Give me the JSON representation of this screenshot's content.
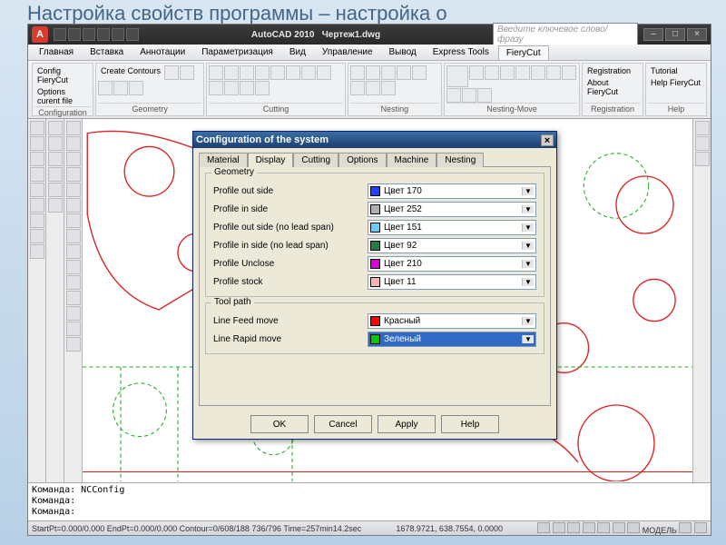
{
  "slide": {
    "title": "Настройка свойств программы – настройка о"
  },
  "titlebar": {
    "app": "AutoCAD 2010",
    "doc": "Чертеж1.dwg",
    "search_placeholder": "Введите ключевое слово/фразу"
  },
  "ribbon": {
    "tabs": [
      "Главная",
      "Вставка",
      "Аннотации",
      "Параметризация",
      "Вид",
      "Управление",
      "Вывод",
      "Express Tools",
      "FieryCut"
    ],
    "panels": [
      {
        "title": "Configuration",
        "items": [
          "Config FieryCut",
          "Options curent file"
        ]
      },
      {
        "title": "Geometry",
        "items": [
          "Create Contours"
        ]
      },
      {
        "title": "Cutting",
        "items": []
      },
      {
        "title": "Nesting",
        "items": []
      },
      {
        "title": "Nesting-Move",
        "items": []
      },
      {
        "title": "Registration",
        "items": [
          "Registration",
          "About FieryCut"
        ]
      },
      {
        "title": "Help",
        "items": [
          "Tutorial",
          "Help FieryCut"
        ]
      }
    ]
  },
  "dialog": {
    "title": "Configuration of the system",
    "tabs": [
      "Material",
      "Display",
      "Cutting",
      "Options",
      "Machine",
      "Nesting"
    ],
    "group1": {
      "title": "Geometry",
      "rows": [
        {
          "label": "Profile out side",
          "value": "Цвет 170",
          "sw": "background:#2040ff"
        },
        {
          "label": "Profile in side",
          "value": "Цвет 252",
          "sw": "background:#b0b0b0"
        },
        {
          "label": "Profile out side (no lead span)",
          "value": "Цвет 151",
          "sw": "background:#66ccff"
        },
        {
          "label": "Profile in side (no lead span)",
          "value": "Цвет 92",
          "sw": "background:#208040"
        },
        {
          "label": "Profile Unclose",
          "value": "Цвет 210",
          "sw": "background:#d800d8"
        },
        {
          "label": "Profile stock",
          "value": "Цвет 11",
          "sw": "background:#ffb0b0"
        }
      ]
    },
    "group2": {
      "title": "Tool path",
      "rows": [
        {
          "label": "Line Feed move",
          "value": "Красный",
          "sw": "background:#ff0000"
        },
        {
          "label": "Line Rapid move",
          "value": "Зеленый",
          "sw": "background:#00c800"
        }
      ]
    },
    "buttons": [
      "OK",
      "Cancel",
      "Apply",
      "Help"
    ]
  },
  "cmd": [
    "Команда: NCConfig",
    "Команда:",
    "Команда:"
  ],
  "status": {
    "left": "StartPt=0.000/0.000  EndPt=0.000/0.000  Contour=0/608/188  736/796 Time=257min14.2sec",
    "coords": "1678.9721, 638.7554, 0.0000",
    "model": "МОДЕЛЬ"
  }
}
